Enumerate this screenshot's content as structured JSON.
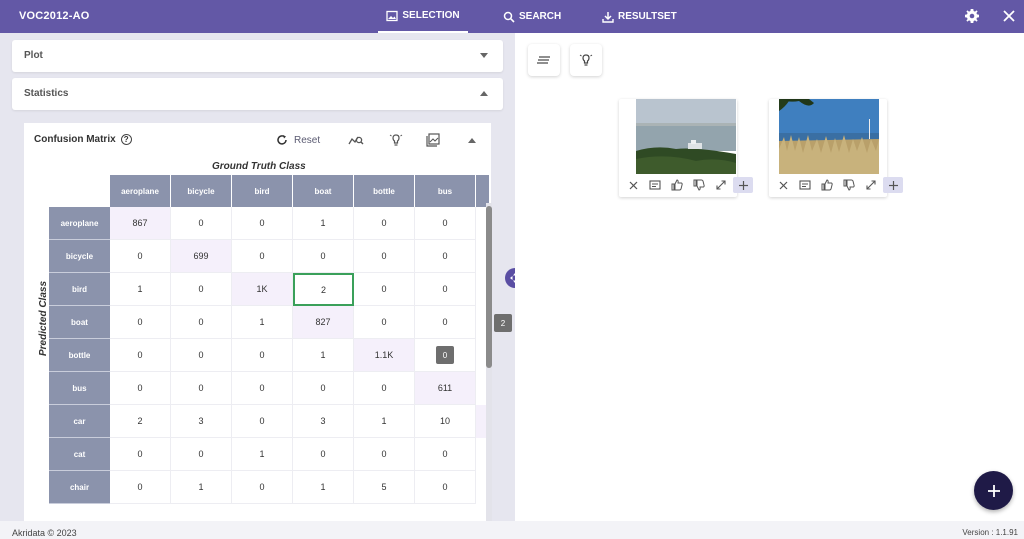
{
  "app": {
    "title": "VOC2012-AO"
  },
  "nav": {
    "selection": "SELECTION",
    "search": "SEARCH",
    "resultset": "RESULTSET"
  },
  "left": {
    "plot_label": "Plot",
    "statistics_label": "Statistics"
  },
  "confusion": {
    "title": "Confusion Matrix",
    "help": "?",
    "reset_label": "Reset",
    "gt_label": "Ground Truth Class",
    "pred_label": "Predicted Class",
    "columns": [
      "aeroplane",
      "bicycle",
      "bird",
      "boat",
      "bottle",
      "bus"
    ],
    "rows": [
      {
        "label": "aeroplane",
        "cells": [
          "867",
          "0",
          "0",
          "1",
          "0",
          "0"
        ]
      },
      {
        "label": "bicycle",
        "cells": [
          "0",
          "699",
          "0",
          "0",
          "0",
          "0"
        ]
      },
      {
        "label": "bird",
        "cells": [
          "1",
          "0",
          "1K",
          "2",
          "0",
          "0"
        ]
      },
      {
        "label": "boat",
        "cells": [
          "0",
          "0",
          "1",
          "827",
          "0",
          "0"
        ]
      },
      {
        "label": "bottle",
        "cells": [
          "0",
          "0",
          "0",
          "1",
          "1.1K",
          ""
        ]
      },
      {
        "label": "bus",
        "cells": [
          "0",
          "0",
          "0",
          "0",
          "0",
          "611"
        ]
      },
      {
        "label": "car",
        "cells": [
          "2",
          "3",
          "0",
          "3",
          "1",
          "10"
        ]
      },
      {
        "label": "cat",
        "cells": [
          "0",
          "0",
          "1",
          "0",
          "0",
          "0"
        ]
      },
      {
        "label": "chair",
        "cells": [
          "0",
          "1",
          "0",
          "1",
          "5",
          "0"
        ]
      }
    ],
    "selected_cell_badge": "2",
    "hover_badge": "0"
  },
  "footer": {
    "copyright": "Akridata © 2023",
    "version": "Version : 1.1.91"
  },
  "colors": {
    "accent": "#6358a6",
    "header_cell": "#8b93ac",
    "fab": "#1f1a47",
    "diag_tint": "#f5f0fb"
  }
}
